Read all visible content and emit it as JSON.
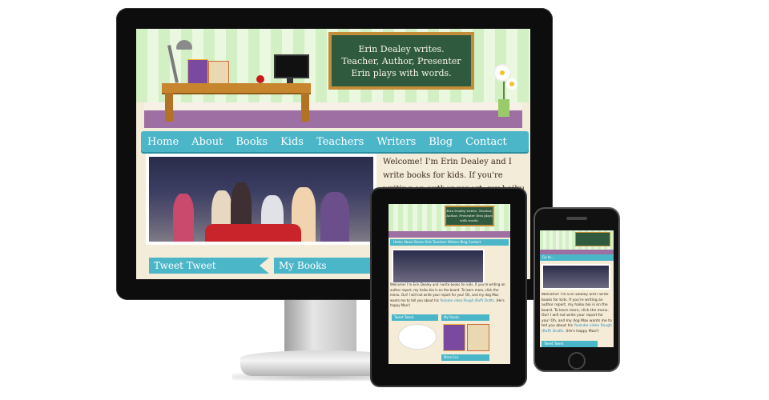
{
  "site": {
    "chalkboard_lines": [
      "Erin Dealey writes.",
      "Teacher, Author, Presenter",
      "Erin plays with words."
    ],
    "nav_items": [
      "Home",
      "About",
      "Books",
      "Kids",
      "Teachers",
      "Writers",
      "Blog",
      "Contact"
    ],
    "welcome_text": "Welcome! I'm Erin Dealey and I write books for kids. If you're writing an author report, my haiku bio is on the board. To",
    "tweet_tab": "Tweet Tweet",
    "books_tab": "My Books"
  },
  "tablet": {
    "chalkboard_text": "Erin Dealey writes. Teacher, Author, Presenter Erin plays with words.",
    "nav_text": "Home  About  Books  Kids  Teachers  Writers  Blog  Contact",
    "welcome_text": "Welcome! I'm Erin Dealey and I write books for kids. If you're writing an author report, my haiku bio is on the board. To learn more, click the menu. Oui! I will not write your report for you! Oh, and my dog Max wants me to tell you about his",
    "welcome_link": "Youtube video Rough (Ruff) Drafts.",
    "welcome_tail": "(He's happy Max!)",
    "tweet_tab": "Tweet Tweet",
    "books_tab": "My Books",
    "more_tab": "More Eco"
  },
  "phone": {
    "nav_text": "Go to...",
    "welcome_text": "Welcome! I'm Erin Dealey and I write books for kids. If you're writing an author report, my haiku bio is on the board. To learn more, click the menu. Oui! I will not write your report for you! Oh, and my dog Max wants me to tell you about his",
    "welcome_link": "Youtube video Rough (Ruff) Drafts.",
    "welcome_tail": "(He's happy Max!)",
    "tweet_tab": "Tweet Tweet"
  },
  "colors": {
    "nav": "#4bb6c8",
    "purple_band": "#9e6fa2",
    "chalkboard": "#2f5a3d",
    "stripe_light": "#e9f8df",
    "stripe_dark": "#d3f0c4"
  }
}
